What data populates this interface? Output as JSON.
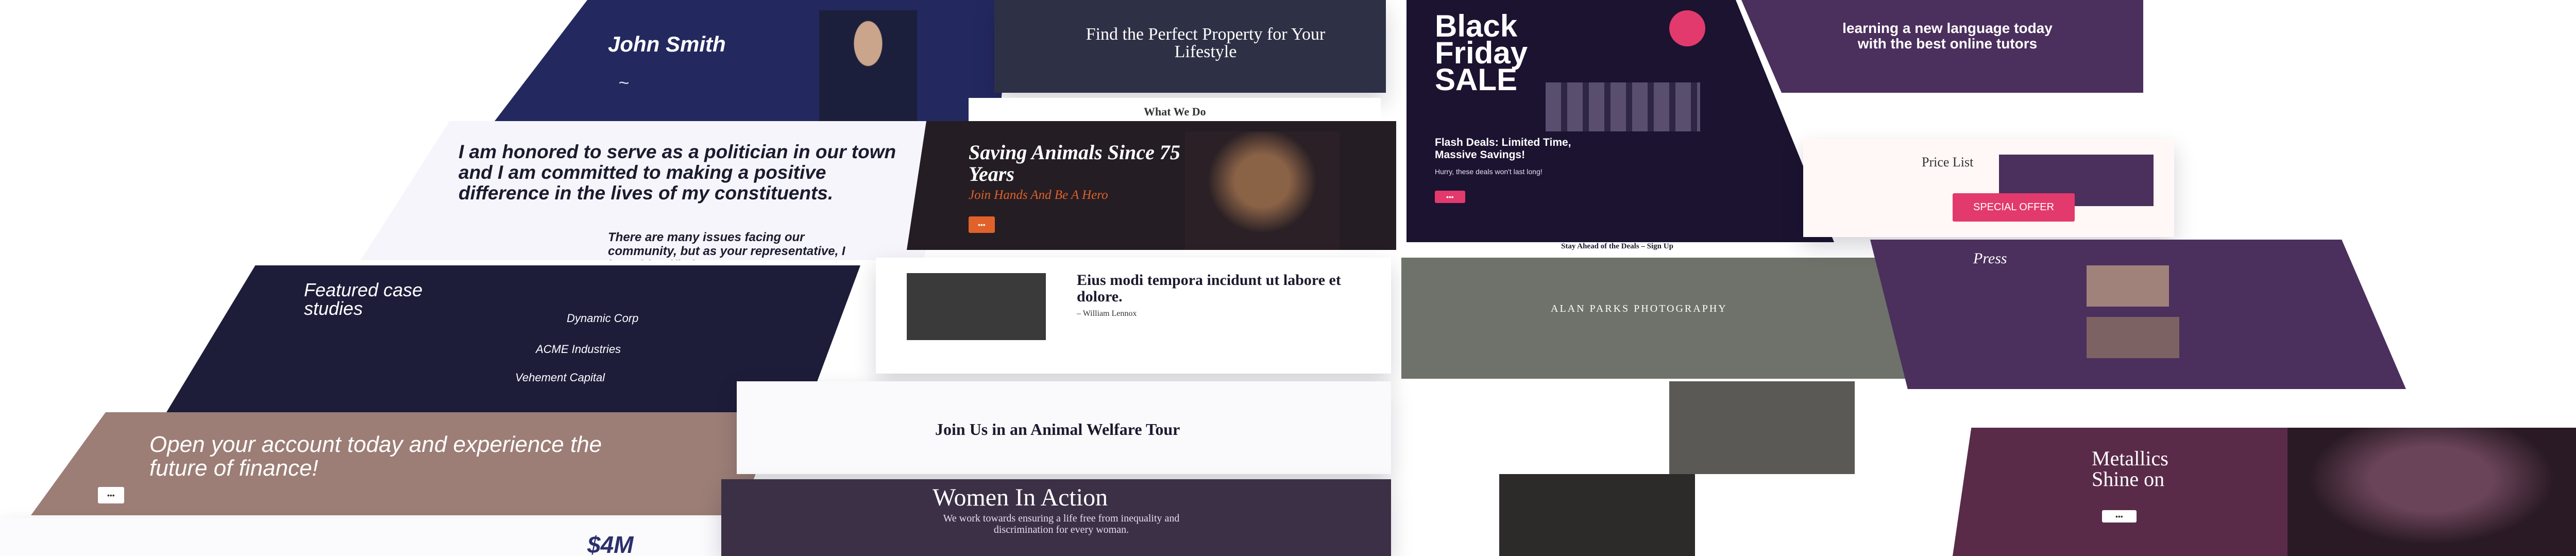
{
  "colors": {
    "navy": "#2b2f6b",
    "plum": "#5a3b6e",
    "orange": "#e0622a",
    "pink": "#e23a6c",
    "mauve": "#9c7e76",
    "dark": "#1d1a2e"
  },
  "politician": {
    "name": "John Smith",
    "quote": "I am honored to serve as a politician in our town and I am committed to making a positive difference in the lives of my constituents.",
    "issues": "There are many issues facing our community, but as your representative, I have identified"
  },
  "finance": {
    "title": "Featured case studies",
    "cases": [
      "Dynamic Corp",
      "ACME Industries",
      "Vehement Capital"
    ],
    "cta_title": "Open your account today and experience the future of finance!",
    "stat": "$4M"
  },
  "property": {
    "title": "Find the Perfect Property for Your Lifestyle",
    "subtitle": "What We Do"
  },
  "animals": {
    "title": "Saving Animals Since 75 Years",
    "tagline": "Join Hands And Be A Hero",
    "quote_title": "Eius modi tempora incidunt ut labore et dolore.",
    "quote_author": "– William Lennox",
    "tour_title": "Join Us in an Animal Welfare Tour"
  },
  "women": {
    "title": "Women In Action",
    "subtitle": "We work towards ensuring a life free from inequality and discrimination for every woman."
  },
  "black_friday": {
    "title": "Black Friday SALE",
    "flash": "Flash Deals: Limited Time, Massive Savings!",
    "hurry": "Hurry, these deals won't last long!",
    "stay": "Stay Ahead of the Deals – Sign Up"
  },
  "wedding": {
    "name": "ALAN PARKS PHOTOGRAPHY"
  },
  "learning": {
    "title": "learning a new language today with the best online tutors"
  },
  "pricing": {
    "title": "Price List",
    "offer": "SPECIAL OFFER",
    "press": "Press"
  },
  "metallics": {
    "title": "Metallics Shine on"
  }
}
